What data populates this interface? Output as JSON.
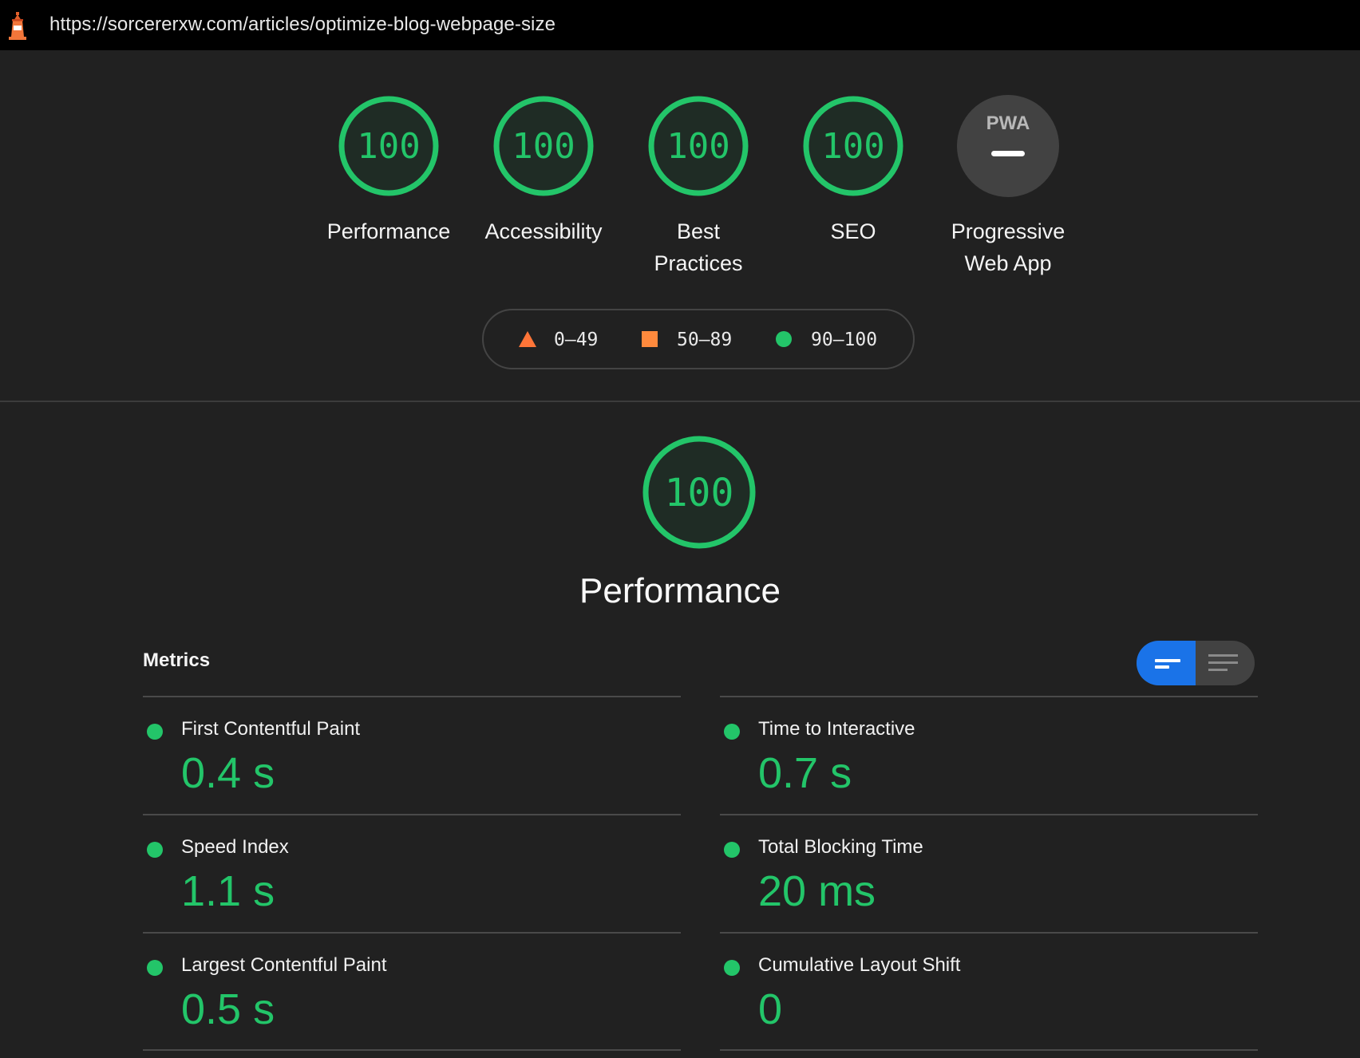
{
  "browser": {
    "url": "https://sorcererxw.com/articles/optimize-blog-webpage-size",
    "logo_icon": "lighthouse-icon"
  },
  "categories": [
    {
      "label": "Performance",
      "score": "100"
    },
    {
      "label": "Accessibility",
      "score": "100"
    },
    {
      "label": "Best Practices",
      "score": "100"
    },
    {
      "label": "SEO",
      "score": "100"
    },
    {
      "label": "Progressive Web App",
      "badge": "PWA"
    }
  ],
  "legend": {
    "fail": "0–49",
    "average": "50–89",
    "pass": "90–100"
  },
  "performance": {
    "score": "100",
    "title": "Performance"
  },
  "metrics": {
    "header": "Metrics",
    "items": [
      {
        "name": "First Contentful Paint",
        "value": "0.4 s"
      },
      {
        "name": "Time to Interactive",
        "value": "0.7 s"
      },
      {
        "name": "Speed Index",
        "value": "1.1 s"
      },
      {
        "name": "Total Blocking Time",
        "value": "20 ms"
      },
      {
        "name": "Largest Contentful Paint",
        "value": "0.5 s"
      },
      {
        "name": "Cumulative Layout Shift",
        "value": "0"
      }
    ]
  },
  "colors": {
    "pass": "#23c569",
    "average": "#ff8a3d",
    "fail": "#ff7538",
    "toggle_active": "#1a73e8"
  }
}
